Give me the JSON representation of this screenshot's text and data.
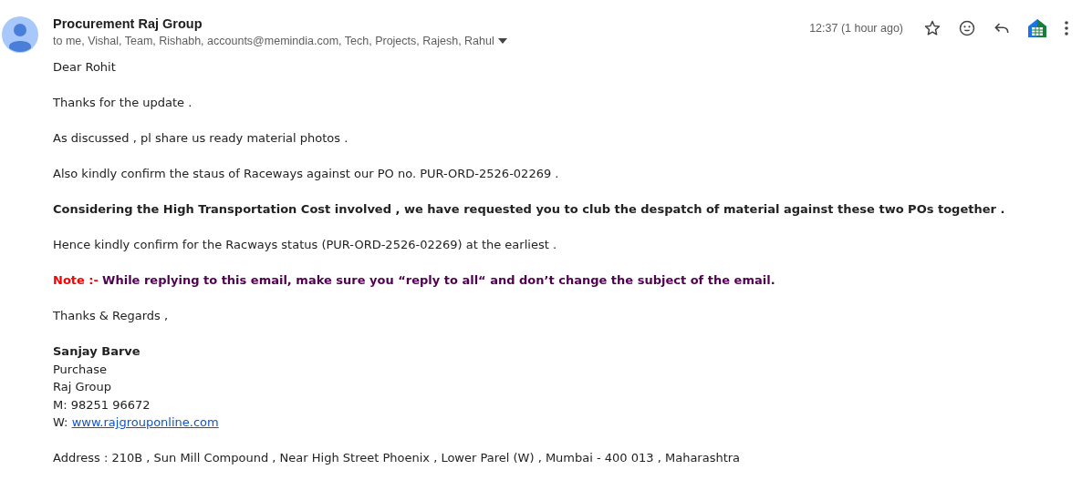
{
  "header": {
    "sender": "Procurement Raj Group",
    "recipients": "to me, Vishal, Team, Rishabh, accounts@memindia.com, Tech, Projects, Rajesh, Rahul",
    "time": "12:37 (1 hour ago)",
    "starred": false
  },
  "body": [
    {
      "kind": "text",
      "text": "Dear Rohit"
    },
    {
      "kind": "text",
      "text": "Thanks for the update ."
    },
    {
      "kind": "text",
      "text": "As discussed , pl share us ready material photos ."
    },
    {
      "kind": "text",
      "text": "Also kindly confirm the staus of Raceways against our PO no. PUR-ORD-2526-02269 ."
    },
    {
      "kind": "bold",
      "text": "Considering the High Transportation Cost involved , we have requested you to club the despatch of material against these two POs together ."
    },
    {
      "kind": "text",
      "text": "Hence kindly confirm for the Racways status (PUR-ORD-2526-02269) at the earliest ."
    },
    {
      "kind": "note",
      "label": "Note :-",
      "text": "While replying to this email, make sure you “reply to all“ and don’t change the subject of the email."
    },
    {
      "kind": "text",
      "text": "Thanks & Regards ,"
    }
  ],
  "signature": {
    "name": "Sanjay Barve",
    "lines": [
      "Purchase",
      "Raj Group",
      "M: 98251 96672"
    ],
    "web_label": "W:",
    "web_link": "www.rajgrouponline.com"
  },
  "address": "Address : 210B , Sun Mill Compound , Near High Street Phoenix , Lower Parel (W) , Mumbai - 400 013 , Maharashtra"
}
